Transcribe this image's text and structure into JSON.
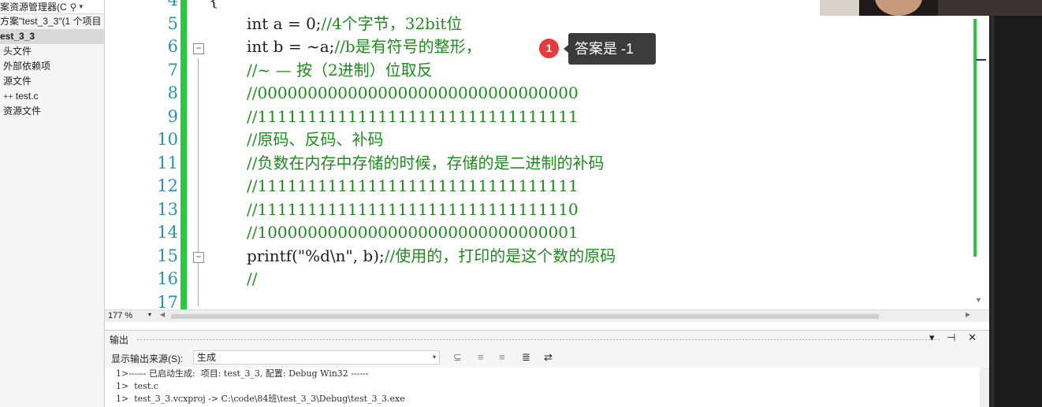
{
  "solution_explorer": {
    "search_text": "案资源管理器(C",
    "items": [
      {
        "label": "方案\"test_3_3\"(1 个项目",
        "selected": false,
        "indent": 0
      },
      {
        "label": "est_3_3",
        "selected": true,
        "indent": 0
      },
      {
        "label": "头文件",
        "selected": false,
        "indent": 1
      },
      {
        "label": "外部依赖项",
        "selected": false,
        "indent": 1
      },
      {
        "label": "源文件",
        "selected": false,
        "indent": 1
      },
      {
        "label": "test.c",
        "selected": false,
        "indent": 1,
        "prefix": "++"
      },
      {
        "label": "资源文件",
        "selected": false,
        "indent": 1
      }
    ]
  },
  "editor": {
    "lines": [
      {
        "num": "4",
        "code": "{",
        "comment": ""
      },
      {
        "num": "5",
        "code": "int a = 0;",
        "comment": "//4个字节，32bit位"
      },
      {
        "num": "6",
        "code": "int b = ~a;",
        "comment": "//b是有符号的整形，"
      },
      {
        "num": "7",
        "code": "",
        "comment": "//~ — 按（2进制）位取反"
      },
      {
        "num": "8",
        "code": "",
        "comment": "//00000000000000000000000000000000"
      },
      {
        "num": "9",
        "code": "",
        "comment": "//11111111111111111111111111111111"
      },
      {
        "num": "10",
        "code": "",
        "comment": "//原码、反码、补码"
      },
      {
        "num": "11",
        "code": "",
        "comment": "//负数在内存中存储的时候，存储的是二进制的补码"
      },
      {
        "num": "12",
        "code": "",
        "comment": "//11111111111111111111111111111111"
      },
      {
        "num": "13",
        "code": "",
        "comment": "//11111111111111111111111111111110"
      },
      {
        "num": "14",
        "code": "",
        "comment": "//10000000000000000000000000000001"
      },
      {
        "num": "15",
        "code": "printf(\"%d\\n\", b);",
        "comment": "//使用的，打印的是这个数的原码"
      },
      {
        "num": "16",
        "code": "",
        "comment": "//"
      },
      {
        "num": "17",
        "code": "",
        "comment": ""
      }
    ]
  },
  "tooltip": {
    "badge": "1",
    "text": "答案是 -1"
  },
  "zoom": {
    "level": "177 %"
  },
  "output": {
    "title": "输出",
    "source_label": "显示输出来源(S):",
    "source_value": "生成",
    "window_controls": "▾ ⊣ ✕",
    "console_lines": [
      "1>------ 已启动生成:  项目: test_3_3, 配置: Debug Win32 ------",
      "1>  test.c",
      "1>  test_3_3.vcxproj -> C:\\code\\84班\\test_3_3\\Debug\\test_3_3.exe"
    ]
  },
  "colors": {
    "line_number": "#2b91af",
    "comment": "#1f8b1f",
    "gutter_green": "#27c93f",
    "tooltip_bg": "#3b3b3b",
    "badge_red": "#e63b3b"
  }
}
